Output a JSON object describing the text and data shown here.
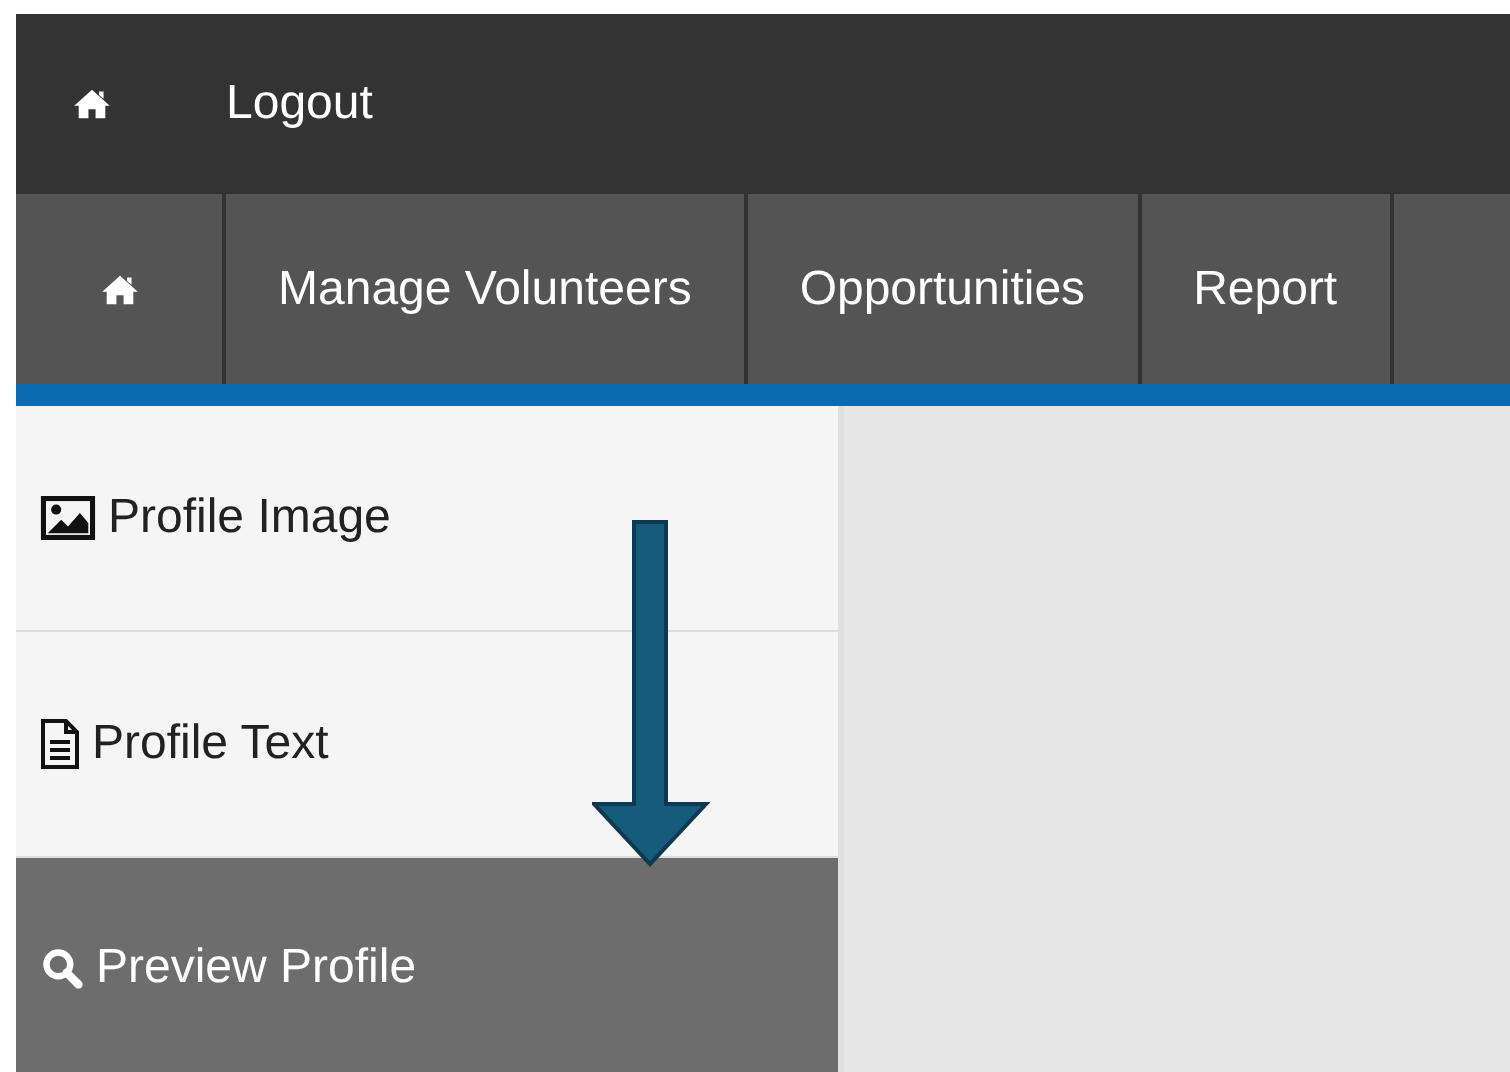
{
  "top_bar": {
    "logout_link": "Logout"
  },
  "nav": {
    "items": [
      {
        "kind": "home"
      },
      {
        "kind": "link",
        "label": "Manage Volunteers"
      },
      {
        "kind": "link",
        "label": "Opportunities"
      },
      {
        "kind": "link",
        "label": "Report"
      }
    ]
  },
  "sidebar": {
    "items": [
      {
        "kind": "image",
        "label": "Profile Image",
        "selected": false
      },
      {
        "kind": "file",
        "label": "Profile Text",
        "selected": false
      },
      {
        "kind": "search",
        "label": "Preview Profile",
        "selected": true
      }
    ]
  }
}
